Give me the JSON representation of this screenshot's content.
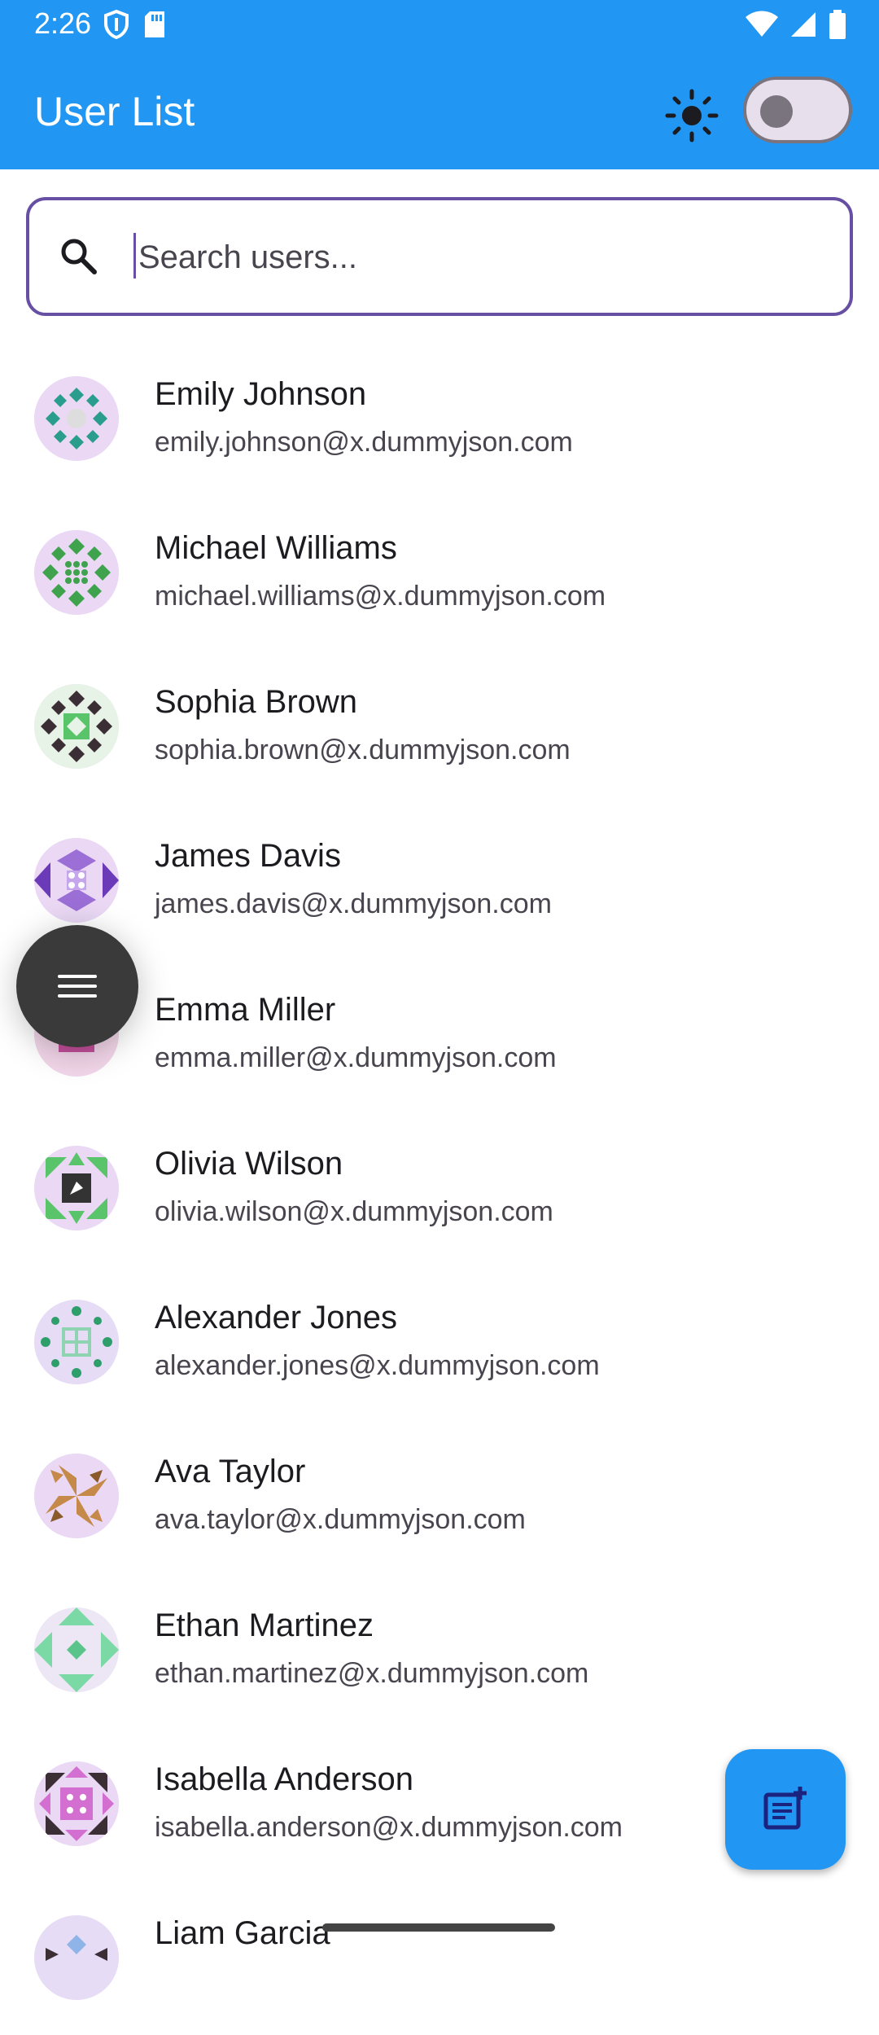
{
  "status_bar": {
    "time": "2:26",
    "left_icons": [
      "shield-icon",
      "sd-card-icon"
    ],
    "right_icons": [
      "wifi-icon",
      "signal-icon",
      "battery-icon"
    ]
  },
  "app_bar": {
    "title": "User List",
    "theme_icon": "sun-icon",
    "dark_mode_enabled": false,
    "background": "#2196f3"
  },
  "search": {
    "placeholder": "Search users...",
    "value": "",
    "icon": "search-icon",
    "outline_color": "#6750a4"
  },
  "users": [
    {
      "name": "Emily Johnson",
      "email": "emily.johnson@x.dummyjson.com"
    },
    {
      "name": "Michael Williams",
      "email": "michael.williams@x.dummyjson.com"
    },
    {
      "name": "Sophia Brown",
      "email": "sophia.brown@x.dummyjson.com"
    },
    {
      "name": "James Davis",
      "email": "james.davis@x.dummyjson.com"
    },
    {
      "name": "Emma Miller",
      "email": "emma.miller@x.dummyjson.com"
    },
    {
      "name": "Olivia Wilson",
      "email": "olivia.wilson@x.dummyjson.com"
    },
    {
      "name": "Alexander Jones",
      "email": "alexander.jones@x.dummyjson.com"
    },
    {
      "name": "Ava Taylor",
      "email": "ava.taylor@x.dummyjson.com"
    },
    {
      "name": "Ethan Martinez",
      "email": "ethan.martinez@x.dummyjson.com"
    },
    {
      "name": "Isabella Anderson",
      "email": "isabella.anderson@x.dummyjson.com"
    },
    {
      "name": "Liam Garcia",
      "email": ""
    }
  ],
  "fabs": {
    "menu_icon": "menu-icon",
    "add_note_icon": "note-add-icon"
  }
}
